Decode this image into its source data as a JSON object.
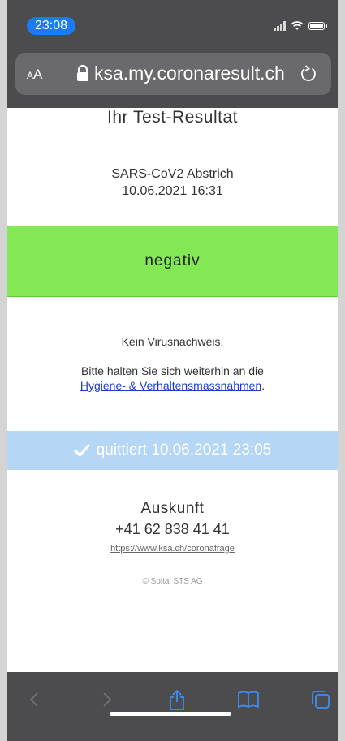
{
  "status_bar": {
    "time": "23:08"
  },
  "address_bar": {
    "text_size_label_small": "A",
    "text_size_label_large": "A",
    "domain": "ksa.my.coronaresult.ch"
  },
  "page": {
    "title": "Ihr Test-Resultat",
    "test_name": "SARS-CoV2 Abstrich",
    "test_datetime": "10.06.2021 16:31",
    "result": "negativ",
    "result_color": "#82e955",
    "message": "Kein Virusnachweis.",
    "hint_prefix": "Bitte halten Sie sich weiterhin an die",
    "hint_link": "Hygiene- & Verhaltensmassnahmen",
    "hint_suffix": ".",
    "acknowledged": "quittiert 10.06.2021 23:05",
    "ack_color": "#b6d6f6",
    "contact_title": "Auskunft",
    "contact_phone": "+41 62 838 41 41",
    "contact_url": "https://www.ksa.ch/coronafrage",
    "copyright": "© Spital STS AG"
  },
  "toolbar": {
    "icons": [
      "back-icon",
      "forward-icon",
      "share-icon",
      "bookmarks-icon",
      "tabs-icon"
    ]
  }
}
